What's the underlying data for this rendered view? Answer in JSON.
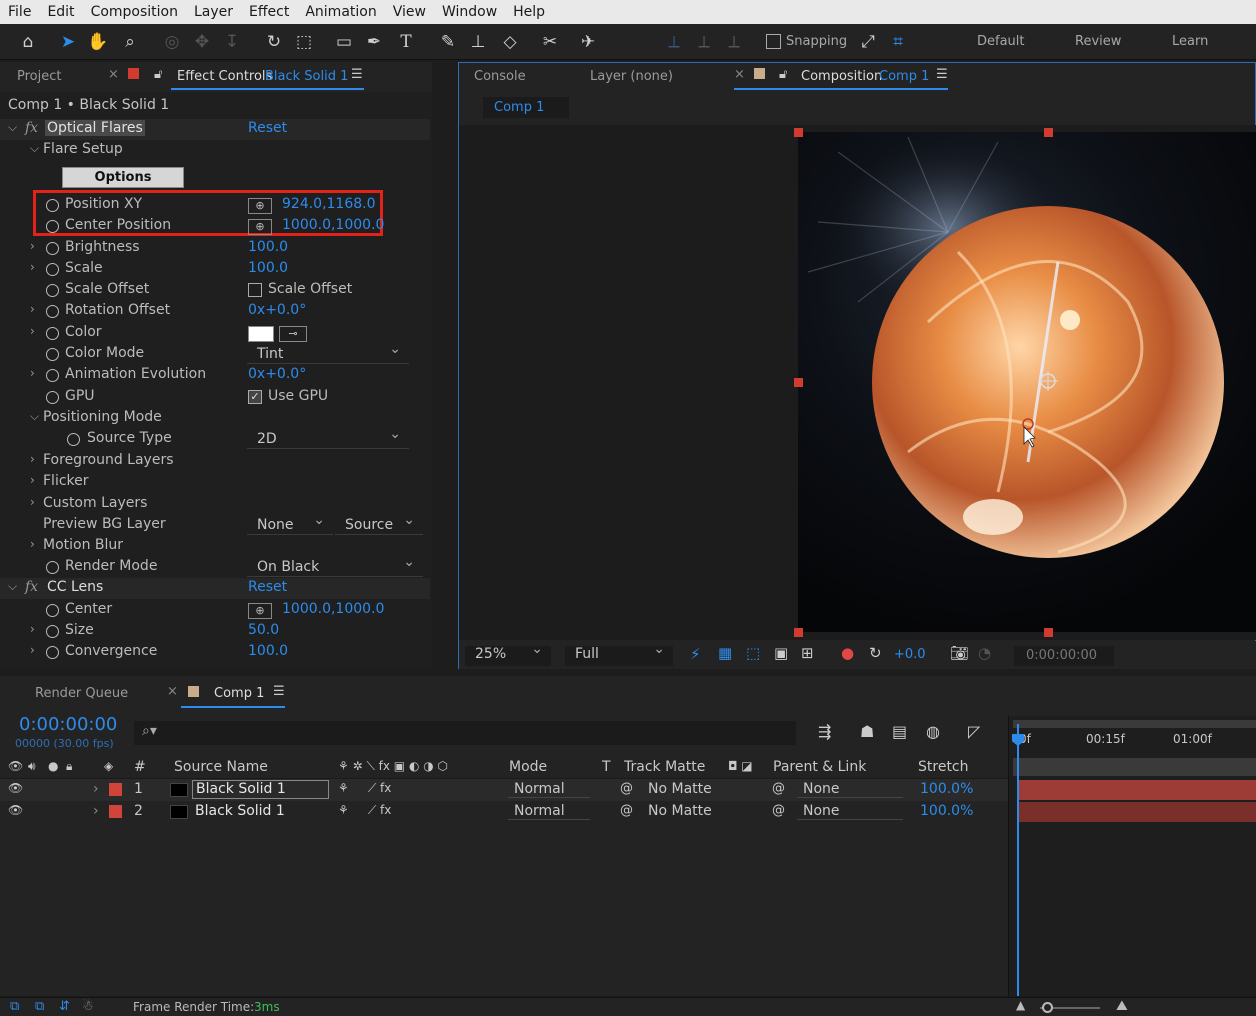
{
  "menu": [
    "File",
    "Edit",
    "Composition",
    "Layer",
    "Effect",
    "Animation",
    "View",
    "Window",
    "Help"
  ],
  "toolbar": {
    "snapping": "Snapping",
    "workspaces": [
      "Default",
      "Review",
      "Learn"
    ]
  },
  "left_tabs": {
    "project": "Project",
    "effect_controls": "Effect Controls",
    "effect_layer": "Black Solid 1"
  },
  "ec": {
    "breadcrumb": "Comp 1 • Black Solid 1",
    "fx1": {
      "name": "Optical Flares",
      "reset": "Reset"
    },
    "flare_setup": "Flare Setup",
    "options": "Options",
    "position_xy": {
      "label": "Position XY",
      "value": "924.0,1168.0"
    },
    "center_position": {
      "label": "Center Position",
      "value": "1000.0,1000.0"
    },
    "brightness": {
      "label": "Brightness",
      "value": "100.0"
    },
    "scale": {
      "label": "Scale",
      "value": "100.0"
    },
    "scale_offset": {
      "label": "Scale Offset",
      "value": "Scale Offset"
    },
    "rotation_offset": {
      "label": "Rotation Offset",
      "value": "0x+0.0°"
    },
    "color": {
      "label": "Color"
    },
    "color_mode": {
      "label": "Color Mode",
      "value": "Tint"
    },
    "anim_evo": {
      "label": "Animation Evolution",
      "value": "0x+0.0°"
    },
    "gpu": {
      "label": "GPU",
      "value": "Use GPU"
    },
    "positioning_mode": "Positioning Mode",
    "source_type": {
      "label": "Source Type",
      "value": "2D"
    },
    "foreground_layers": "Foreground Layers",
    "flicker": "Flicker",
    "custom_layers": "Custom Layers",
    "preview_bg": {
      "label": "Preview BG Layer",
      "value1": "None",
      "value2": "Source"
    },
    "motion_blur": "Motion Blur",
    "render_mode": {
      "label": "Render Mode",
      "value": "On Black"
    },
    "fx2": {
      "name": "CC Lens",
      "reset": "Reset"
    },
    "center": {
      "label": "Center",
      "value": "1000.0,1000.0"
    },
    "size": {
      "label": "Size",
      "value": "50.0"
    },
    "convergence": {
      "label": "Convergence",
      "value": "100.0"
    }
  },
  "comp_tabs": {
    "console": "Console",
    "layer": "Layer (none)",
    "composition": "Composition",
    "comp_name": "Comp 1",
    "sub_tab": "Comp 1"
  },
  "viewer_bar": {
    "zoom": "25%",
    "resolution": "Full",
    "exposure": "+0.0",
    "timecode": "0:00:00:00"
  },
  "timeline_tabs": {
    "render_queue": "Render Queue",
    "comp": "Comp 1"
  },
  "timeline": {
    "timecode": "0:00:00:00",
    "frames": "00000 (30.00 fps)",
    "headers": {
      "num": "#",
      "source_name": "Source Name",
      "mode": "Mode",
      "t": "T",
      "track_matte": "Track Matte",
      "parent": "Parent & Link",
      "stretch": "Stretch"
    },
    "ruler": [
      "0f",
      "00:15f",
      "01:00f"
    ],
    "layers": [
      {
        "num": "1",
        "name": "Black Solid 1",
        "mode": "Normal",
        "matte": "No Matte",
        "parent": "None",
        "stretch": "100.0%"
      },
      {
        "num": "2",
        "name": "Black Solid 1",
        "mode": "Normal",
        "matte": "No Matte",
        "parent": "None",
        "stretch": "100.0%"
      }
    ]
  },
  "status": {
    "label": "Frame Render Time:",
    "value": "3ms"
  },
  "colors": {
    "accent": "#2d8ceb",
    "highlight": "#e2231a",
    "layer_label": "#d0443a",
    "orb": "#e89a5a"
  }
}
